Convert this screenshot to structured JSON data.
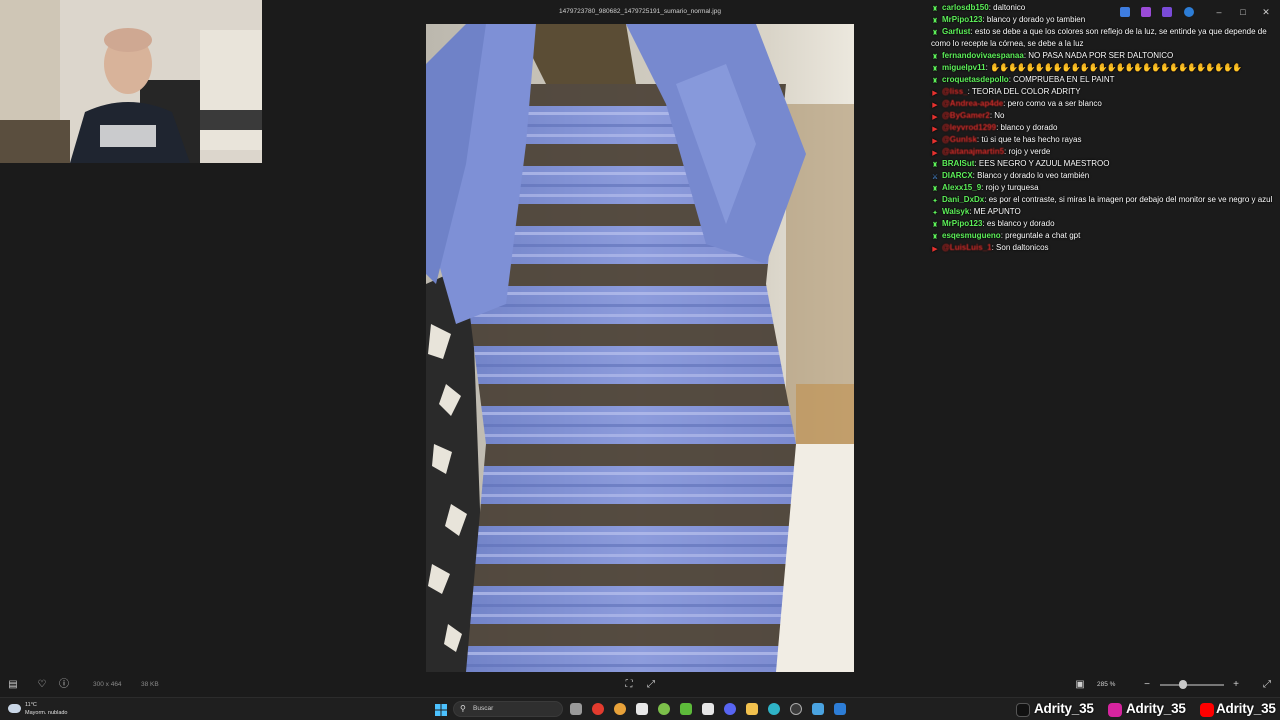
{
  "viewer": {
    "file_title": "1479723780_980682_1479725191_sumario_normal.jpg",
    "image_size": "300 x 464",
    "file_size": "38 KB",
    "zoom": "285 %"
  },
  "chat": [
    {
      "user": "carlosdb150",
      "color": "green",
      "badge": "gift",
      "message": "daltonico"
    },
    {
      "user": "MrPipo123",
      "color": "green",
      "badge": "gift",
      "message": "blanco y dorado yo tambien"
    },
    {
      "user": "Garfust",
      "color": "green",
      "badge": "gift",
      "message": "esto se debe a que los colores son reflejo de la luz, se entinde ya que depende de como lo recepte la córnea, se debe a la luz"
    },
    {
      "user": "fernandovivaespanaa",
      "color": "green",
      "badge": "gift",
      "message": "NO PASA NADA POR SER DALTONICO"
    },
    {
      "user": "miguelpv11",
      "color": "green",
      "badge": "gift",
      "message": "",
      "emotes": 28
    },
    {
      "user": "croquetasdepollo",
      "color": "green",
      "badge": "gift",
      "message": "COMPRUEBA EN EL PAINT"
    },
    {
      "user": "@liss_",
      "color": "red",
      "badge": "youtube",
      "message": "TEORIA DEL COLOR ADRITY"
    },
    {
      "user": "@Andrea-ap4de",
      "color": "red",
      "badge": "youtube",
      "message": "pero como va a ser blanco"
    },
    {
      "user": "@ByGamer2",
      "color": "red",
      "badge": "youtube",
      "message": "No"
    },
    {
      "user": "@leyvrod1299",
      "color": "red",
      "badge": "youtube",
      "message": "blanco y dorado"
    },
    {
      "user": "@Gunlsk",
      "color": "red",
      "badge": "youtube",
      "message": "tú si que te has hecho rayas"
    },
    {
      "user": "@aitanajmartin5",
      "color": "red",
      "badge": "youtube",
      "message": "rojo y verde"
    },
    {
      "user": "BRAISut",
      "color": "green",
      "badge": "gift",
      "message": "EES NEGRO Y AZUUL MAESTROO"
    },
    {
      "user": "DIARCX",
      "color": "green",
      "badge": "sword",
      "message": "Blanco y dorado lo veo también"
    },
    {
      "user": "Alexx15_9",
      "color": "green",
      "badge": "gift",
      "message": "rojo y turquesa"
    },
    {
      "user": "Dani_DxDx",
      "color": "green",
      "badge": "diamond",
      "message": "es por el contraste, si miras la imagen por debajo del monitor se ve negro y azul"
    },
    {
      "user": "Walsyk",
      "color": "green",
      "badge": "diamond",
      "message": "ME APUNTO"
    },
    {
      "user": "MrPipo123",
      "color": "green",
      "badge": "gift",
      "message": "es blanco y dorado"
    },
    {
      "user": "esqesmugueno",
      "color": "green",
      "badge": "gift",
      "message": "preguntale a chat gpt"
    },
    {
      "user": "@LuisLuis_1",
      "color": "red",
      "badge": "youtube",
      "message": "Son daltonicos"
    }
  ],
  "taskbar": {
    "weather_temp": "11°C",
    "weather_desc": "Mayorm. nublado",
    "search_placeholder": "Buscar"
  },
  "socials": [
    {
      "platform": "tiktok",
      "handle": "Adrity_35"
    },
    {
      "platform": "instagram",
      "handle": "Adrity_35"
    },
    {
      "platform": "youtube",
      "handle": "Adrity_35"
    }
  ],
  "colors": {
    "chat_green": "#5ef05a",
    "chat_red": "#e5322f",
    "dress_blue": "#7f8fd4",
    "dress_lace": "#5a4a2c"
  }
}
